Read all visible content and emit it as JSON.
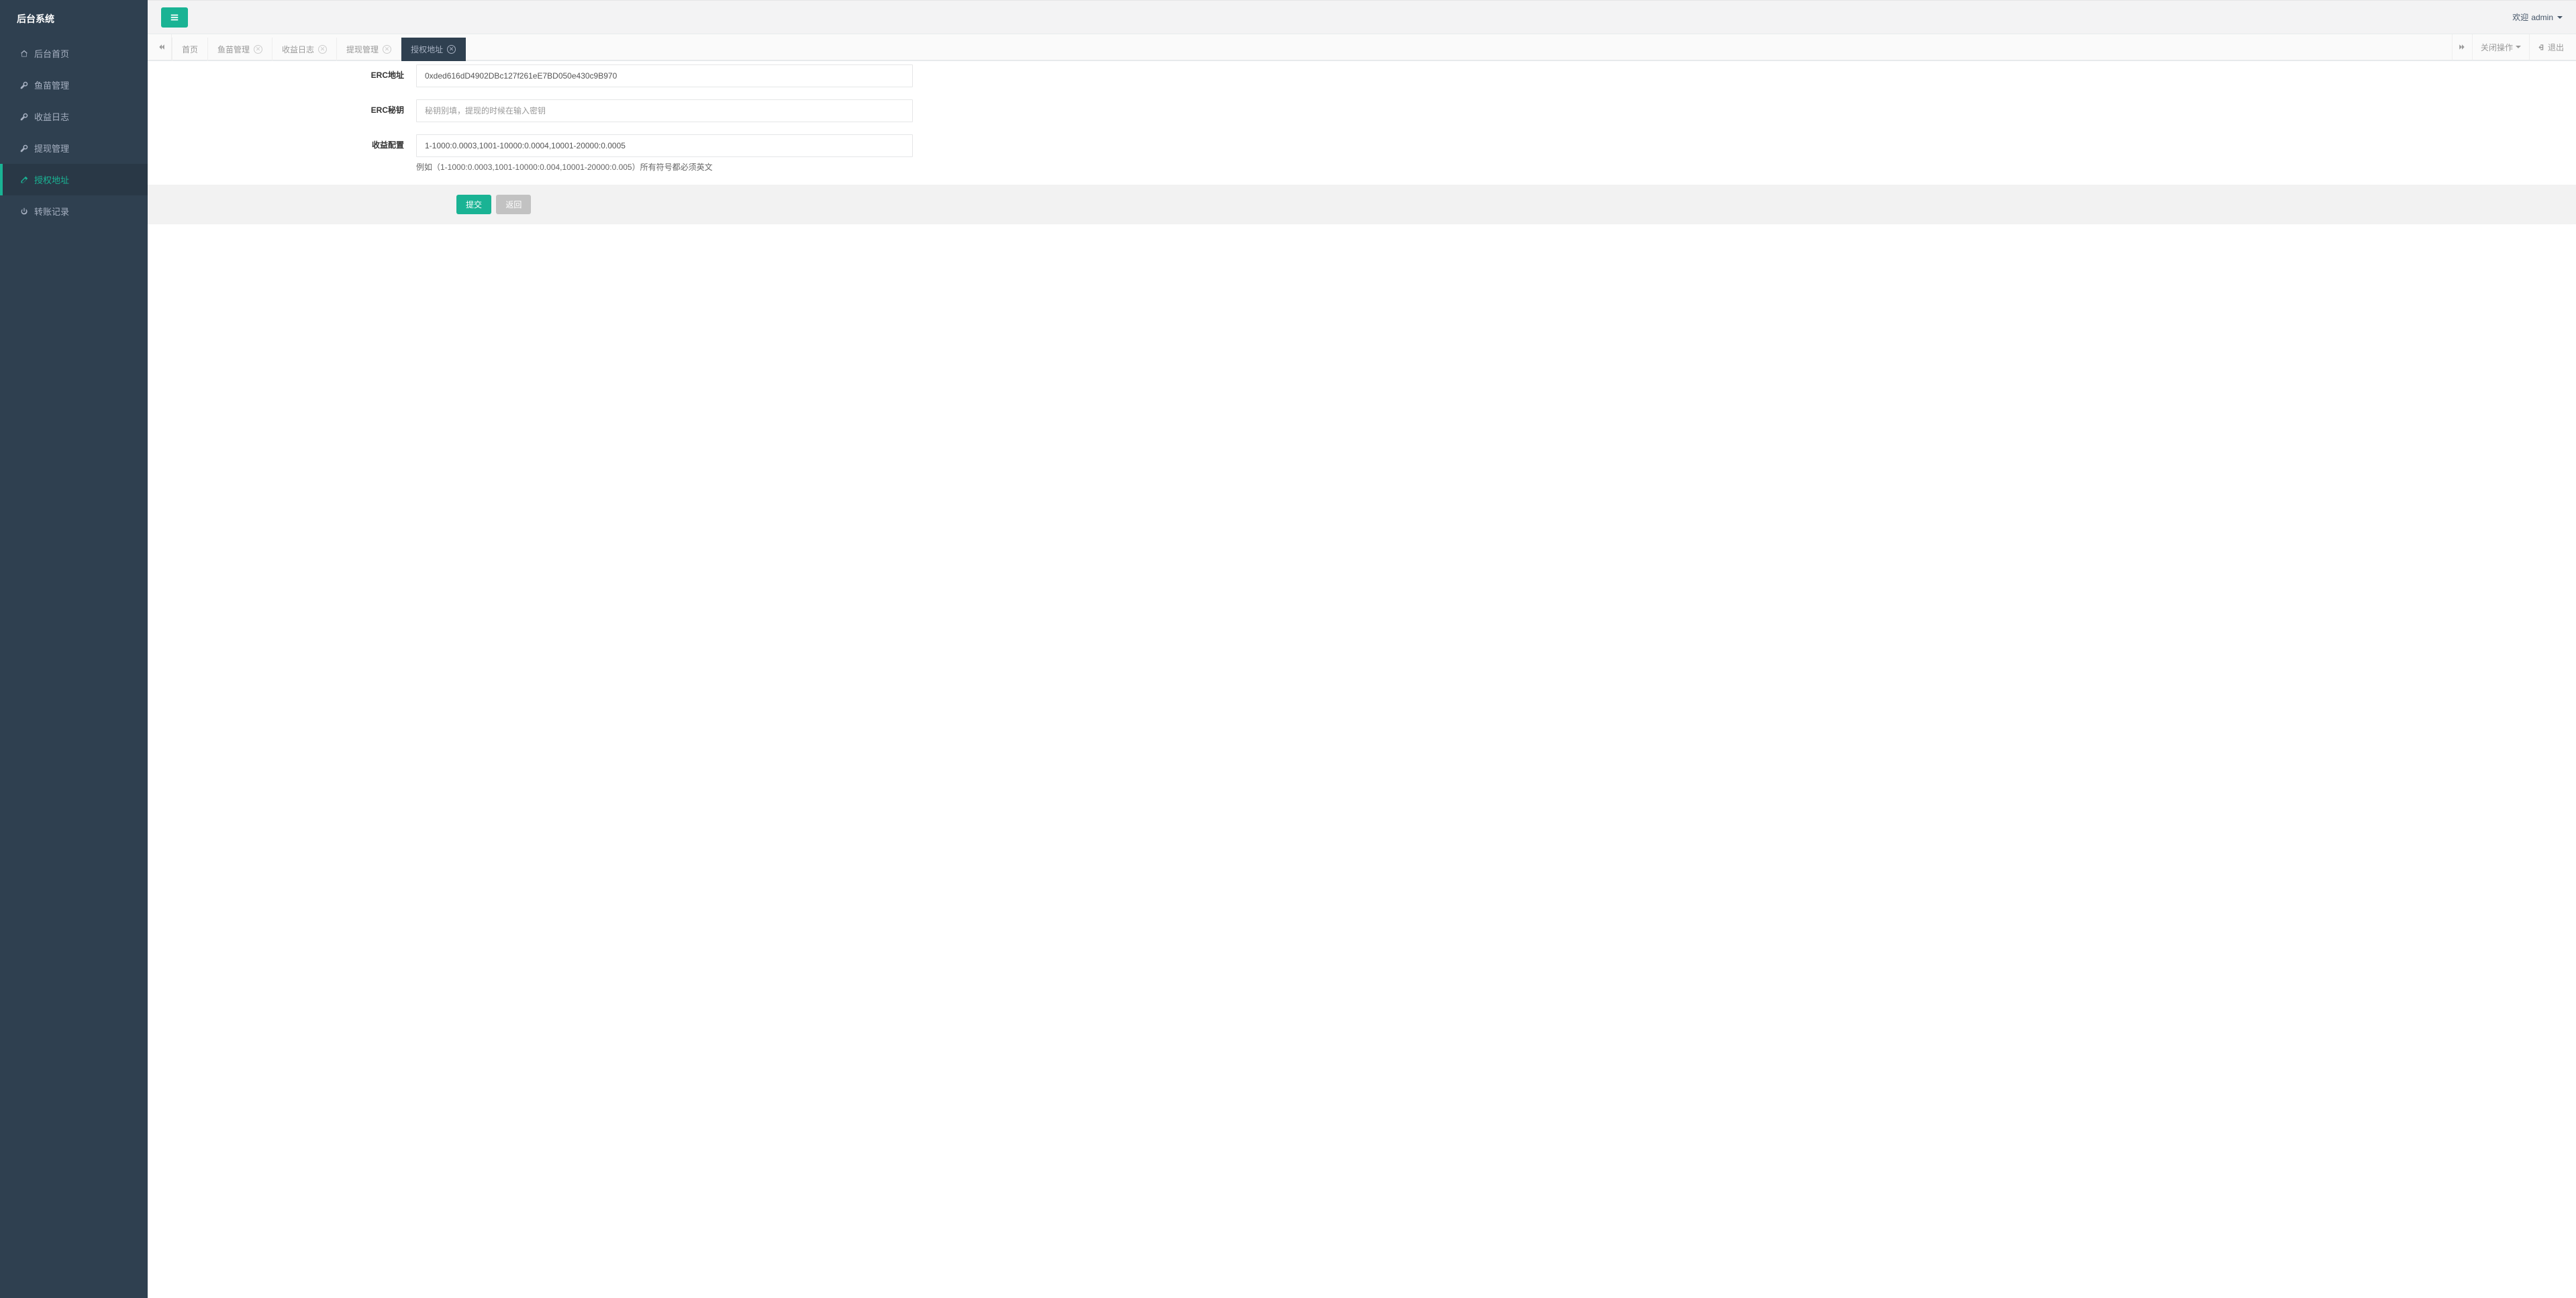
{
  "app": {
    "title": "后台系统"
  },
  "sidebar": {
    "items": [
      {
        "label": "后台首页",
        "icon": "home-icon"
      },
      {
        "label": "鱼苗管理",
        "icon": "wrench-icon"
      },
      {
        "label": "收益日志",
        "icon": "wrench-icon"
      },
      {
        "label": "提现管理",
        "icon": "wrench-icon"
      },
      {
        "label": "授权地址",
        "icon": "edit-icon",
        "active": true
      },
      {
        "label": "转账记录",
        "icon": "power-icon"
      }
    ]
  },
  "topbar": {
    "welcome_prefix": "欢迎 ",
    "username": "admin"
  },
  "tabs": {
    "items": [
      {
        "label": "首页",
        "closable": false
      },
      {
        "label": "鱼苗管理",
        "closable": true
      },
      {
        "label": "收益日志",
        "closable": true
      },
      {
        "label": "提现管理",
        "closable": true
      },
      {
        "label": "授权地址",
        "closable": true,
        "active": true
      }
    ],
    "close_ops_label": "关闭操作",
    "logout_label": "退出"
  },
  "form": {
    "erc_address": {
      "label": "ERC地址",
      "value": "0xded616dD4902DBc127f261eE7BD050e430c9B970"
    },
    "erc_secret": {
      "label": "ERC秘钥",
      "placeholder": "秘钥别填，提现的时候在输入密钥"
    },
    "profit_config": {
      "label": "收益配置",
      "value": "1-1000:0.0003,1001-10000:0.0004,10001-20000:0.0005",
      "help": "例如（1-1000:0.0003,1001-10000:0.004,10001-20000:0.005）所有符号都必须英文"
    },
    "submit_label": "提交",
    "back_label": "返回"
  }
}
